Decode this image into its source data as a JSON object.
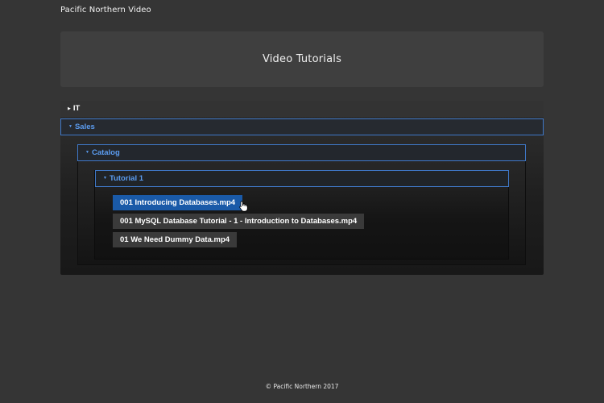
{
  "brand": "Pacific Northern Video",
  "hero_title": "Video Tutorials",
  "tree": {
    "it": {
      "label": "IT",
      "expanded": false
    },
    "sales": {
      "label": "Sales",
      "expanded": true,
      "catalog": {
        "label": "Catalog",
        "expanded": true,
        "tutorial": {
          "label": "Tutorial 1",
          "expanded": true,
          "files": [
            {
              "label": "001 Introducing Databases.mp4",
              "active": true
            },
            {
              "label": "001 MySQL Database Tutorial - 1 - Introduction to Databases.mp4",
              "active": false
            },
            {
              "label": "01 We Need Dummy Data.mp4",
              "active": false
            }
          ]
        }
      }
    }
  },
  "icons": {
    "collapsed": "triangle-right-icon",
    "expanded": "triangle-down-icon",
    "cursor": "hand-pointer-icon"
  },
  "colors": {
    "page_bg": "#353535",
    "hero_bg": "#3f3f3f",
    "accent": "#3f78c8",
    "accent_text": "#5b9cf0",
    "active_file": "#1a5aa8",
    "file_bg": "#3a3a3a"
  },
  "footer": "© Pacific Northern 2017"
}
